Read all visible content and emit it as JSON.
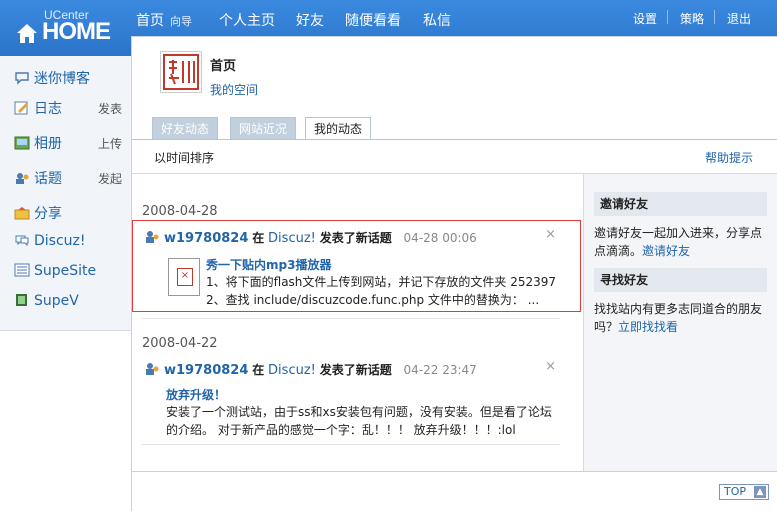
{
  "logo": {
    "top": "UCenter",
    "bottom": "HOME"
  },
  "nav": [
    {
      "label": "首页",
      "sub": "向导"
    },
    {
      "label": "个人主页"
    },
    {
      "label": "好友"
    },
    {
      "label": "随便看看"
    },
    {
      "label": "私信"
    }
  ],
  "right_nav": [
    "设置",
    "策略",
    "退出"
  ],
  "sidebar": [
    {
      "label": "迷你博客",
      "icon": "comment-icon"
    },
    {
      "label": "日志",
      "sub": "发表",
      "icon": "blog-icon"
    },
    {
      "label": "相册",
      "sub": "上传",
      "icon": "album-icon"
    },
    {
      "label": "话题",
      "sub": "发起",
      "icon": "topic-icon"
    },
    {
      "label": "分享",
      "icon": "share-icon"
    },
    {
      "label": "Discuz!",
      "icon": "discuz-icon"
    },
    {
      "label": "SupeSite",
      "icon": "supesite-icon"
    },
    {
      "label": "SupeV",
      "icon": "supev-icon"
    }
  ],
  "header": {
    "title": "首页",
    "myspace": "我的空间"
  },
  "tabs": [
    "好友动态",
    "网站近况",
    "我的动态"
  ],
  "active_tab": "我的动态",
  "sort_label": "以时间排序",
  "help_tip": "帮助提示",
  "feeds": [
    {
      "date": "2008-04-28",
      "user": "w19780824",
      "in": "在",
      "site": "Discuz!",
      "action": "发表了新话题",
      "time": "04-28 00:06",
      "title": "秀一下贴内mp3播放器",
      "line1": "1、将下面的flash文件上传到网站，并记下存放的文件夹 252397",
      "line2": "2、查找 include/discuzcode.func.php 文件中的替换为： ..."
    },
    {
      "date": "2008-04-22",
      "user": "w19780824",
      "in": "在",
      "site": "Discuz!",
      "action": "发表了新话题",
      "time": "04-22 23:47",
      "title": "放弃升级！",
      "line1": "安装了一个测试站，由于ss和xs安装包有问题，没有安装。但是看了论坛",
      "line2": "的介绍。 对于新产品的感觉一个字：乱！！！ 放弃升级！！！:lol"
    }
  ],
  "right_panel": {
    "invite_title": "邀请好友",
    "invite_text": "邀请好友一起加入进来，分享点点滴滴。",
    "invite_link": "邀请好友",
    "find_title": "寻找好友",
    "find_text": "找找站内有更多志同道合的朋友吗？",
    "find_link": "立即找找看"
  },
  "top_button": "TOP",
  "colors": {
    "topbar": "#2f7ed8",
    "link": "#2165a8",
    "highlight": "#e03b3b"
  }
}
